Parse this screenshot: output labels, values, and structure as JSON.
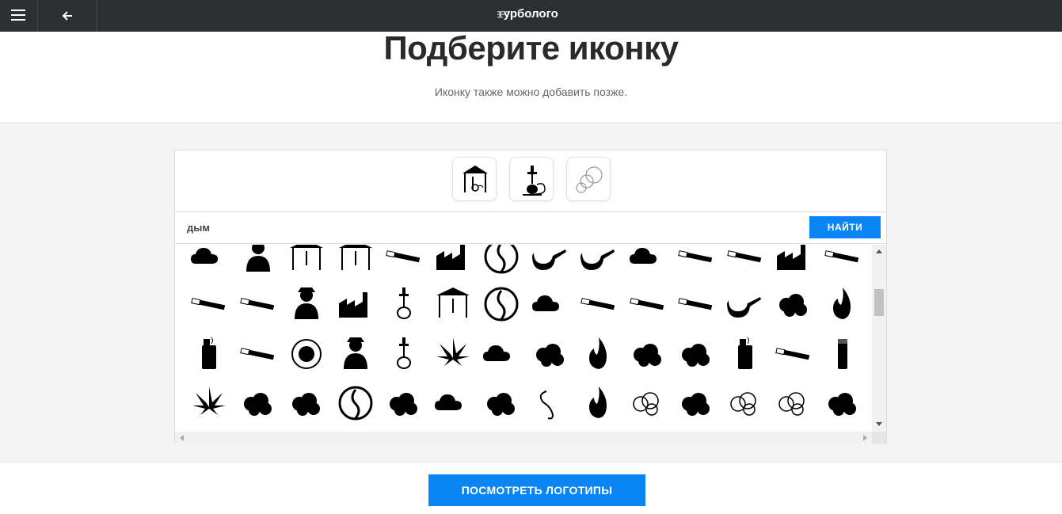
{
  "header": {
    "brand": "турболого",
    "menu_icon": "hamburger-menu-icon",
    "back_icon": "arrow-left-icon"
  },
  "hero": {
    "title": "Подберите иконку",
    "subtitle": "Иконку также можно добавить позже."
  },
  "selected_icons": [
    "gazebo-hookah-icon",
    "hookah-icon",
    "smoke-cloud-icon"
  ],
  "search": {
    "value": "дым",
    "button_label": "НАЙТИ"
  },
  "icon_grid": [
    [
      "cloud-icon",
      "people-smoke-icon",
      "hookah-bar-icon",
      "hookah-bar-outline-icon",
      "cigarette-icon",
      "factory-icon",
      "smoke-alarm-icon",
      "pipe-icon",
      "pipe-curved-icon",
      "grill-icon",
      "e-cigarette-icon",
      "cigarette-pack-icon",
      "factory-chimney-icon",
      "lighter-tool-icon"
    ],
    [
      "cigar-icon",
      "cigar-band-icon",
      "sherlock-icon",
      "factory-smoke-icon",
      "hookah-outline-icon",
      "gazebo-hookah-icon",
      "smoke-detector-icon",
      "magic-lamp-icon",
      "cigarette-smoke-icon",
      "cigar-smoke-icon",
      "cigarette-smoke-long-icon",
      "pipe-thin-icon",
      "smoke-puff-icon",
      "fire-barrel-icon"
    ],
    [
      "lighter-zippo-icon",
      "cigarette-hand-icon",
      "ashtray-icon",
      "incense-icon",
      "bong-icon",
      "cannabis-leaf-icon",
      "no-smoking-cloud-icon",
      "mushroom-cloud-icon",
      "flame-icon",
      "dragon-cloud-icon",
      "rocket-launch-icon",
      "zippo-icon",
      "cigarette-small-icon",
      "lighter-icon"
    ],
    [
      "cannabis-icon",
      "smoke-big-icon",
      "smoke-wisp-icon",
      "smoke-circle-icon",
      "smoke-blob-icon",
      "cloud-small-icon",
      "smoke-ball-icon",
      "smoke-swirl-icon",
      "smoke-torch-icon",
      "cloud-outline-icon",
      "smoke-cluster-icon",
      "smoke-stack-icon",
      "smoke-rings-icon",
      "smoke-cloud-bolt-icon"
    ]
  ],
  "footer": {
    "cta_label": "ПОСМОТРЕТЬ ЛОГОТИПЫ"
  },
  "colors": {
    "topbar": "#2d3032",
    "accent": "#0a85f5"
  }
}
